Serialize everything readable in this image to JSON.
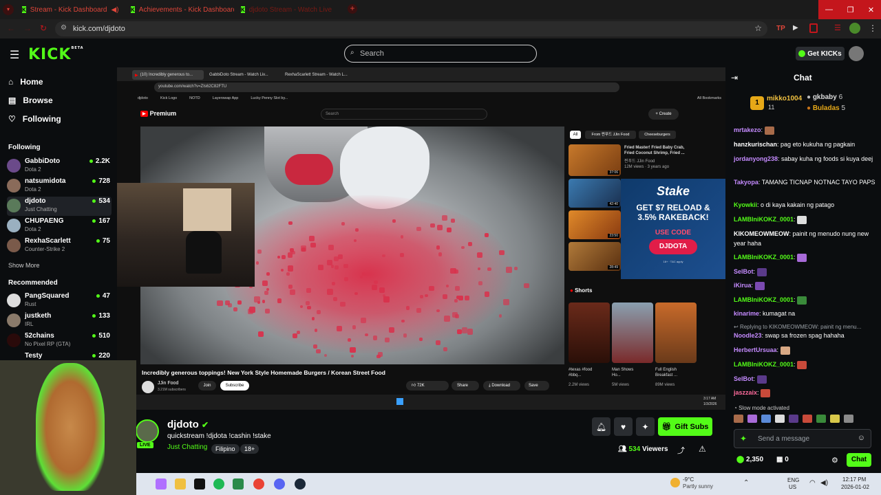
{
  "browser": {
    "tabs": [
      "Stream - Kick Dashboard",
      "Achievements - Kick Dashboard",
      "djdoto Stream - Watch Live"
    ],
    "url": "kick.com/djdoto"
  },
  "header": {
    "logo": "KICK",
    "logo_sup": "BETA",
    "search_placeholder": "Search",
    "get_kicks": "Get KICKs"
  },
  "sidebar": {
    "nav": [
      "Home",
      "Browse",
      "Following"
    ],
    "following_title": "Following",
    "following": [
      {
        "name": "GabbiDoto",
        "game": "Dota 2",
        "viewers": "2.2K"
      },
      {
        "name": "natsumidota",
        "game": "Dota 2",
        "viewers": "728"
      },
      {
        "name": "djdoto",
        "game": "Just Chatting",
        "viewers": "534"
      },
      {
        "name": "CHUPAENG",
        "game": "Dota 2",
        "viewers": "167"
      },
      {
        "name": "RexhaScarlett",
        "game": "Counter-Strike 2",
        "viewers": "75"
      }
    ],
    "show_more": "Show More",
    "recommended_title": "Recommended",
    "recommended": [
      {
        "name": "PangSquared",
        "game": "Rust",
        "viewers": "47"
      },
      {
        "name": "justketh",
        "game": "IRL",
        "viewers": "133"
      },
      {
        "name": "52chains",
        "game": "No Pixel RP (GTA)",
        "viewers": "510"
      },
      {
        "name": "Testy",
        "game": "",
        "viewers": "220"
      }
    ]
  },
  "stream_screen": {
    "tabs": [
      "(10) Incredibly generous to...",
      "GabbiDoto Stream - Watch Liv...",
      "RexhaScarlett Stream - Watch L..."
    ],
    "url": "youtube.com/watch?v=ZIs62C82FTU",
    "bookmarks": [
      "djdoto",
      "Kick Logo",
      "NOTD",
      "Layerswap App",
      "Lucky Penny Slot by...",
      "All Bookmarks"
    ],
    "yt_logo": "Premium",
    "yt_search": "Search",
    "create": "Create",
    "video_title": "Incredibly generous toppings! New York Style Homemade Burgers / Korean Street Food",
    "channel": "JJin Food",
    "subs": "3.21M subscribers",
    "join": "Join",
    "subscribe": "Subscribe",
    "likes": "72K",
    "share": "Share",
    "download": "Download",
    "save": "Save",
    "chips": [
      "All",
      "From 찐푸드 JJin Food",
      "Cheeseburgers"
    ],
    "rec_title": "Fried Master! Fried Baby Crab, Fried Coconut Shrimp, Fried ...",
    "rec_channel": "찐푸드 JJin Food",
    "rec_meta": "12M views · 3 years ago",
    "durations": [
      "37:06",
      "42:40",
      "23:50",
      "28:49"
    ],
    "ad": {
      "brand": "Stake",
      "line1": "GET $7 RELOAD &",
      "line2": "3.5% RAKEBACK!",
      "code_label": "USE CODE",
      "code": "DJDOTA",
      "fine": "18+ · T&C apply"
    },
    "shorts_title": "Shorts",
    "shorts": [
      {
        "title": "#texas #food #bbq...",
        "views": "2.2M views"
      },
      {
        "title": "Man Shows Ho...",
        "views": "5M views"
      },
      {
        "title": "Full English Breakfast ...",
        "views": "89M views"
      }
    ],
    "clock_time": "3:17 AM",
    "clock_date": "1/3/2026"
  },
  "stream_info": {
    "streamer": "djdoto",
    "title": "quickstream !djdota !cashin !stake",
    "category": "Just Chatting",
    "tags": [
      "Filipino",
      "18+"
    ],
    "live": "LIVE",
    "viewers": "534",
    "viewers_label": "Viewers",
    "gift_subs": "Gift Subs"
  },
  "chat": {
    "title": "Chat",
    "top": [
      {
        "rank": "1",
        "name": "mikko1004",
        "count": "11"
      },
      {
        "name": "gkbaby",
        "count": "6"
      },
      {
        "name": "Buladas",
        "count": "5"
      }
    ],
    "messages": [
      {
        "user": "mrtakezo",
        "text": "",
        "color": "#c58bff"
      },
      {
        "user": "hanzkurischan",
        "text": "pag eto kukuha ng pagkain",
        "color": "#ffffff"
      },
      {
        "user": "jordanyong238",
        "text": "sabay kuha ng foods si kuya deej",
        "color": "#c58bff"
      },
      {
        "user": "Takyopa",
        "text": "TAMANG TICNAP NOTNAC TAYO PAPS",
        "color": "#c58bff"
      },
      {
        "user": "Kyowkii",
        "text": "o di kaya kakain ng patago",
        "color": "#53fc18"
      },
      {
        "user": "LAMBIniKOKZ_0001",
        "text": "",
        "color": "#53fc18"
      },
      {
        "user": "KIKOMEOWMEOW",
        "text": "painit ng menudo nung new year haha",
        "color": "#ffffff"
      },
      {
        "user": "LAMBIniKOKZ_0001",
        "text": "",
        "color": "#53fc18"
      },
      {
        "user": "SelBot",
        "text": "",
        "color": "#c58bff"
      },
      {
        "user": "iKirua",
        "text": "",
        "color": "#c58bff"
      },
      {
        "user": "LAMBIniKOKZ_0001",
        "text": "",
        "color": "#53fc18"
      },
      {
        "user": "kinarime",
        "text": "kumagat na",
        "color": "#c58bff"
      },
      {
        "user": "Noodle23",
        "text": "swap sa frozen spag hahaha",
        "color": "#c58bff"
      },
      {
        "user": "HerbertUrsuaa",
        "text": "",
        "color": "#c58bff"
      },
      {
        "user": "LAMBIniKOKZ_0001",
        "text": "",
        "color": "#53fc18"
      },
      {
        "user": "SelBot",
        "text": "",
        "color": "#c58bff"
      },
      {
        "user": "jaszzaix",
        "text": "",
        "color": "#ff6b9d"
      }
    ],
    "reply_note": "Replying to KIKOMEOWMEOW: painit ng menu...",
    "slow_mode": "Slow mode activated",
    "send_placeholder": "Send a message",
    "points": "2,350",
    "count": "0",
    "chat_button": "Chat"
  },
  "taskbar": {
    "weather_temp": "-9°C",
    "weather_text": "Partly sunny",
    "lang": "ENG",
    "region": "US",
    "time": "12:17 PM",
    "date": "2026-01-02"
  },
  "colors": {
    "kick_green": "#53fc18",
    "bg": "#0b0d0f",
    "tab_red": "#c4161c",
    "yt_red": "#ff0000"
  }
}
